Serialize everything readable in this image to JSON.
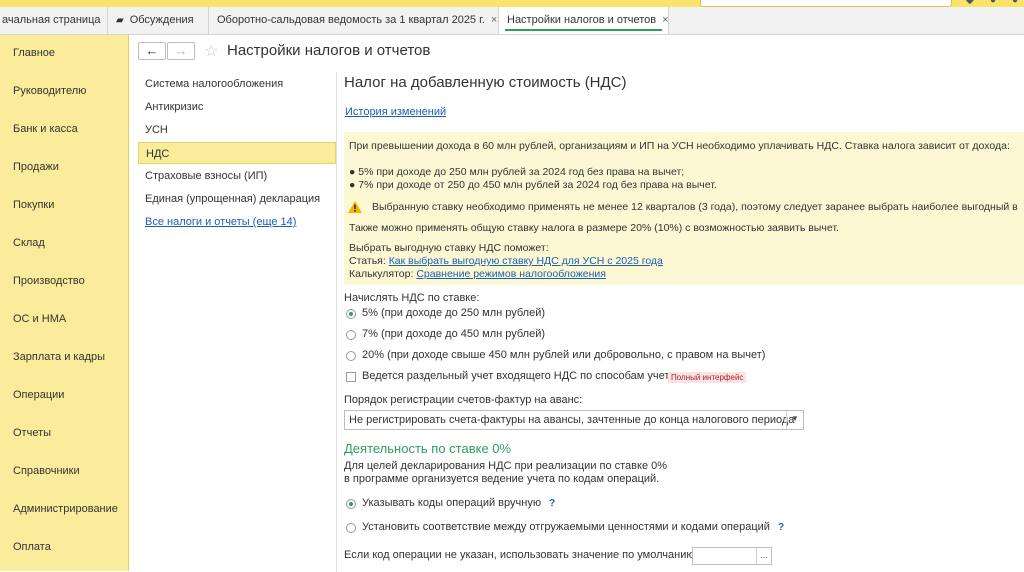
{
  "tabs": [
    {
      "label": "ачальная страница"
    },
    {
      "label": "Обсуждения"
    },
    {
      "label": "Оборотно-сальдовая ведомость за 1 квартал 2025 г."
    },
    {
      "label": "Настройки налогов и отчетов"
    }
  ],
  "tab_close": "×",
  "nav": [
    "Главное",
    "Руководителю",
    "Банк и касса",
    "Продажи",
    "Покупки",
    "Склад",
    "Производство",
    "ОС и НМА",
    "Зарплата и кадры",
    "Операции",
    "Отчеты",
    "Справочники",
    "Администрирование",
    "Оплата"
  ],
  "header": {
    "back": "←",
    "forward": "→",
    "star": "☆",
    "title": "Настройки налогов и отчетов"
  },
  "sections": [
    {
      "label": "Система налогообложения"
    },
    {
      "label": "Антикризис"
    },
    {
      "label": "УСН"
    },
    {
      "label": "НДС"
    },
    {
      "label": "Страховые взносы (ИП)"
    },
    {
      "label": "Единая (упрощенная) декларация"
    },
    {
      "label": "Все налоги и отчеты (еще 14)"
    }
  ],
  "main": {
    "title": "Налог на добавленную стоимость (НДС)",
    "history_link": "История изменений",
    "info": {
      "line1": "При превышении дохода в 60 млн рублей, организациям и ИП на УСН необходимо уплачивать НДС. Ставка налога зависит от дохода:",
      "bullet1": "● 5% при доходе до 250 млн рублей за 2024 год без права на вычет;",
      "bullet2": "● 7% при доходе от 250 до 450 млн рублей за 2024 год без права на вычет.",
      "warning": "Выбранную ставку необходимо применять не менее 12 кварталов (3 года), поэтому следует заранее выбрать наиболее выгодный в",
      "also": "Также можно применять общую ставку налога в размере 20% (10%) с возможностью заявить вычет.",
      "help": "Выбрать выгодную ставку НДС поможет:",
      "article_label": "Статья:",
      "article_link": "Как выбрать выгодную ставку НДС для УСН с 2025 года",
      "calc_label": "Калькулятор:",
      "calc_link": "Сравнение режимов налогообложения"
    },
    "rate_label": "Начислять НДС по ставке:",
    "rates": [
      {
        "label": "5% (при доходе до 250 млн рублей)",
        "selected": true
      },
      {
        "label": "7% (при доходе до 450 млн рублей)",
        "selected": false
      },
      {
        "label": "20% (при доходе свыше 450 млн рублей или добровольно, с правом на вычет)",
        "selected": false
      }
    ],
    "separate_check": {
      "label": "Ведется раздельный учет входящего НДС по способам учета",
      "checked": false,
      "badge": "Полный интерфейс"
    },
    "invoice_label": "Порядок регистрации счетов-фактур на аванс:",
    "invoice_value": "Не регистрировать счета-фактуры на авансы, зачтенные до конца налогового периода",
    "zero_title": "Деятельность по ставке 0%",
    "zero_desc1": "Для целей декларирования НДС при реализации по ставке 0%",
    "zero_desc2": "в программе организуется ведение учета по кодам операций.",
    "zero_options": [
      {
        "label": "Указывать коды операций вручную",
        "selected": true
      },
      {
        "label": "Установить соответствие между отгружаемыми ценностями и кодами операций",
        "selected": false
      }
    ],
    "help_mark": "?",
    "default_label": "Если код операции не указан, использовать значение по умолчанию:",
    "default_value": "",
    "dots": "..."
  },
  "colors": {
    "accent_green": "#2e9e5a",
    "nav_bg": "#fbec9b",
    "info_bg": "#fdf8d4",
    "link": "#1a5fb4"
  }
}
